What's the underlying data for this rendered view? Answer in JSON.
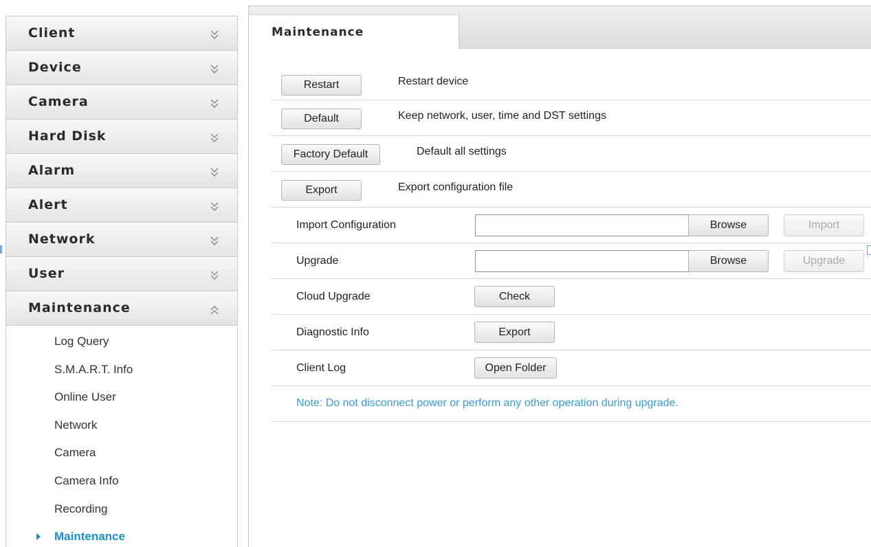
{
  "sidebar": {
    "categories": [
      {
        "label": "Client",
        "icon": "chevron-double-down-icon"
      },
      {
        "label": "Device",
        "icon": "chevron-double-down-icon"
      },
      {
        "label": "Camera",
        "icon": "chevron-double-down-icon"
      },
      {
        "label": "Hard Disk",
        "icon": "chevron-double-down-icon"
      },
      {
        "label": "Alarm",
        "icon": "chevron-double-down-icon"
      },
      {
        "label": "Alert",
        "icon": "chevron-double-down-icon"
      },
      {
        "label": "Network",
        "icon": "chevron-double-down-icon"
      },
      {
        "label": "User",
        "icon": "chevron-double-down-icon"
      },
      {
        "label": "Maintenance",
        "icon": "chevron-double-up-icon",
        "expanded": true
      }
    ],
    "maintenance_items": [
      {
        "label": "Log Query"
      },
      {
        "label": "S.M.A.R.T. Info"
      },
      {
        "label": "Online User"
      },
      {
        "label": "Network"
      },
      {
        "label": "Camera"
      },
      {
        "label": "Camera Info"
      },
      {
        "label": "Recording"
      },
      {
        "label": "Maintenance",
        "active": true
      }
    ]
  },
  "main": {
    "tab_title": "Maintenance",
    "restart": {
      "button": "Restart",
      "description": "Restart device"
    },
    "default": {
      "button": "Default",
      "description": "Keep network, user, time and DST settings"
    },
    "factory_default": {
      "button": "Factory Default",
      "description": "Default all settings"
    },
    "export_config": {
      "button": "Export",
      "description": "Export configuration file"
    },
    "import_config": {
      "label": "Import Configuration",
      "value": "",
      "browse": "Browse",
      "action": "Import"
    },
    "upgrade": {
      "label": "Upgrade",
      "value": "",
      "browse": "Browse",
      "action": "Upgrade"
    },
    "cloud_upgrade": {
      "label": "Cloud Upgrade",
      "button": "Check"
    },
    "diagnostic_info": {
      "label": "Diagnostic Info",
      "button": "Export"
    },
    "client_log": {
      "label": "Client Log",
      "button": "Open Folder"
    },
    "note": "Note: Do not disconnect power or perform any other operation during upgrade."
  },
  "colors": {
    "accent": "#1a8fc6",
    "note": "#3a9ccf"
  }
}
